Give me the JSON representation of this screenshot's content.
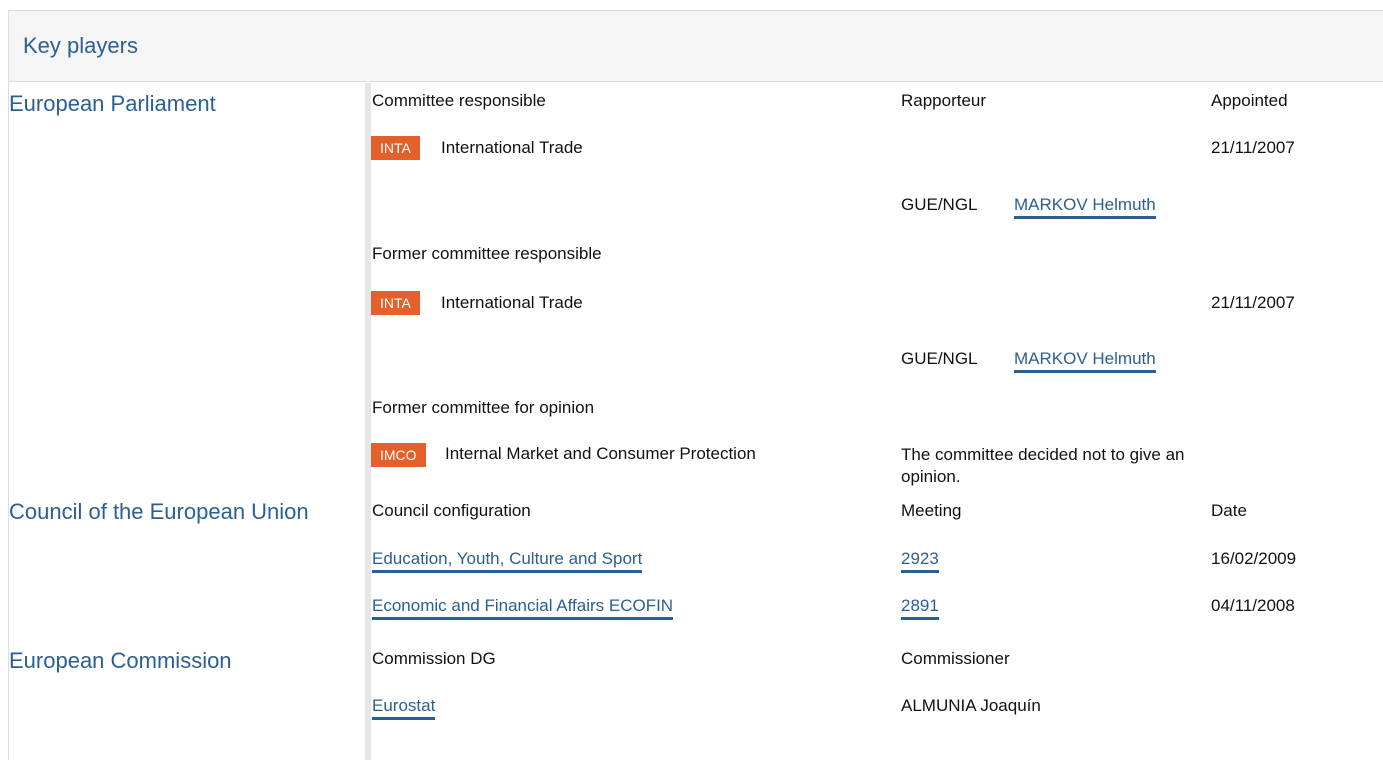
{
  "header": {
    "title": "Key players"
  },
  "ep": {
    "label": "European Parliament",
    "col_committee": "Committee responsible",
    "col_rapporteur": "Rapporteur",
    "col_appointed": "Appointed",
    "r1": {
      "badge": "INTA",
      "name": "International Trade",
      "date": "21/11/2007",
      "group": "GUE/NGL",
      "person": "MARKOV Helmuth"
    },
    "former_label": "Former committee responsible",
    "r2": {
      "badge": "INTA",
      "name": "International Trade",
      "date": "21/11/2007",
      "group": "GUE/NGL",
      "person": "MARKOV Helmuth"
    },
    "former_opinion_label": "Former committee for opinion",
    "r3": {
      "badge": "IMCO",
      "name": "Internal Market and Consumer Protection",
      "note": "The committee decided not to give an opinion."
    }
  },
  "council": {
    "label": "Council of the European Union",
    "col_config": "Council configuration",
    "col_meeting": "Meeting",
    "col_date": "Date",
    "rows": [
      {
        "config": "Education, Youth, Culture and Sport",
        "meeting": "2923",
        "date": "16/02/2009"
      },
      {
        "config": "Economic and Financial Affairs ECOFIN",
        "meeting": "2891",
        "date": "04/11/2008"
      }
    ]
  },
  "commission": {
    "label": "European Commission",
    "col_dg": "Commission DG",
    "col_commissioner": "Commissioner",
    "dg": "Eurostat",
    "commissioner": "ALMUNIA Joaquín"
  }
}
